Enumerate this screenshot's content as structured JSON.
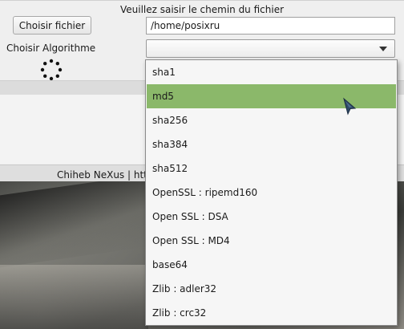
{
  "window": {
    "title": "Veuillez saisir le chemin du fichier",
    "choose_file_button": "Choisir fichier",
    "path_value": "/home/posixru",
    "algorithm_label": "Choisir Algorithme",
    "combo_value": "",
    "footer_text": "Chiheb NeXus | htt"
  },
  "dropdown": {
    "selected_index": 1,
    "selected_color": "#8bb86a",
    "items": [
      "sha1",
      "md5",
      "sha256",
      "sha384",
      "sha512",
      "OpenSSL : ripemd160",
      "Open SSL : DSA",
      "Open SSL : MD4",
      "base64",
      "Zlib : adler32",
      "Zlib : crc32"
    ]
  },
  "icons": {
    "spinner": "busy-spinner-icon",
    "combo_arrow": "chevron-down-icon",
    "cursor": "mouse-pointer-icon"
  }
}
